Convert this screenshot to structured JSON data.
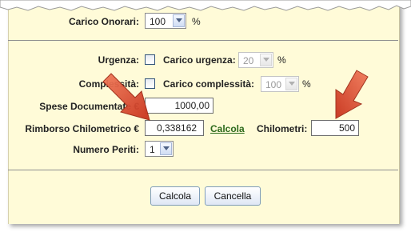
{
  "carico_onorari": {
    "label": "Carico Onorari:",
    "value": "100",
    "unit": "%"
  },
  "urgenza": {
    "label": "Urgenza:",
    "checked": false
  },
  "carico_urgenza": {
    "label": "Carico urgenza:",
    "value": "20",
    "unit": "%"
  },
  "complessita": {
    "label": "Complessità:",
    "checked": false
  },
  "carico_complessita": {
    "label": "Carico complessità:",
    "value": "100",
    "unit": "%"
  },
  "spese_documentate": {
    "label": "Spese Documentate €",
    "value": "1000,00"
  },
  "rimborso_chilometrico": {
    "label": "Rimborso Chilometrico €",
    "value": "0,338162",
    "link": "Calcola"
  },
  "chilometri": {
    "label": "Chilometri:",
    "value": "500"
  },
  "numero_periti": {
    "label": "Numero Periti:",
    "value": "1"
  },
  "buttons": {
    "calcola": "Calcola",
    "cancella": "Cancella"
  },
  "colors": {
    "background": "#fffbd8",
    "link": "#2d6a1b",
    "arrow": "#e04a2c"
  }
}
